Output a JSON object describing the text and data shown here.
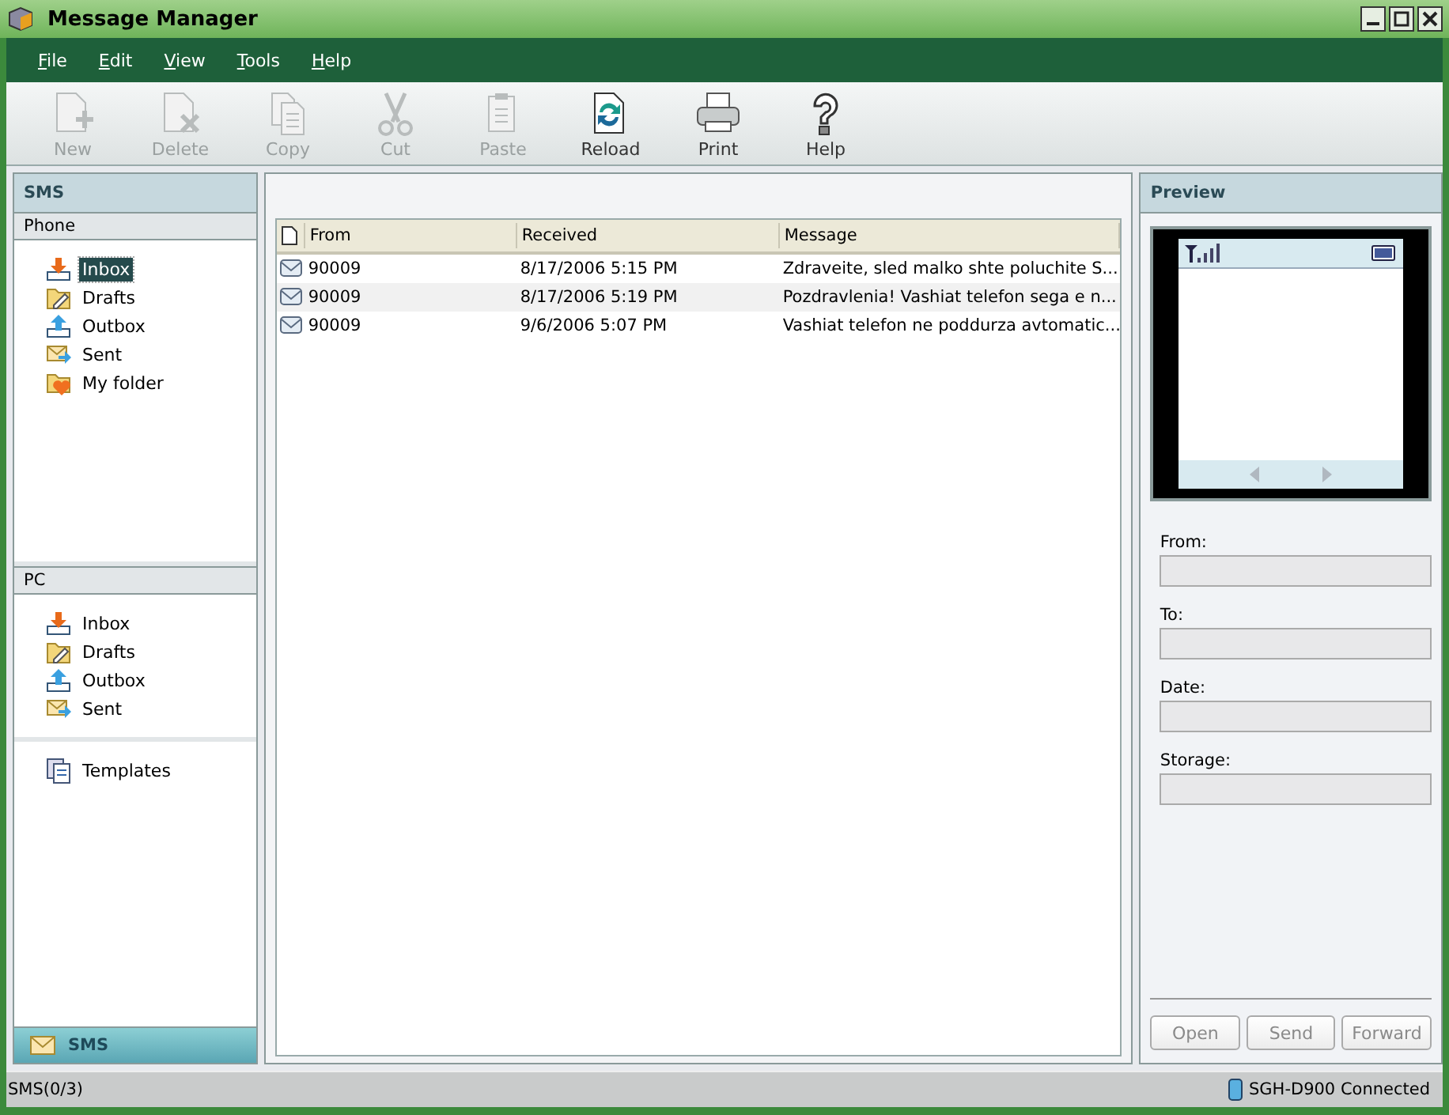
{
  "window": {
    "title": "Message Manager"
  },
  "menu": [
    {
      "label": "File"
    },
    {
      "label": "Edit"
    },
    {
      "label": "View"
    },
    {
      "label": "Tools"
    },
    {
      "label": "Help"
    }
  ],
  "toolbar": [
    {
      "label": "New",
      "kind": "new",
      "disabled": true
    },
    {
      "label": "Delete",
      "kind": "delete",
      "disabled": true
    },
    {
      "label": "Copy",
      "kind": "copy",
      "disabled": true
    },
    {
      "label": "Cut",
      "kind": "cut",
      "disabled": true
    },
    {
      "label": "Paste",
      "kind": "paste",
      "disabled": true
    },
    {
      "label": "Reload",
      "kind": "reload",
      "disabled": false
    },
    {
      "label": "Print",
      "kind": "print",
      "disabled": false
    },
    {
      "label": "Help",
      "kind": "help",
      "disabled": false
    }
  ],
  "sidebar": {
    "title": "SMS",
    "sections": [
      {
        "title": "Phone",
        "items": [
          {
            "label": "Inbox",
            "kind": "inbox",
            "selected": true
          },
          {
            "label": "Drafts",
            "kind": "drafts",
            "selected": false
          },
          {
            "label": "Outbox",
            "kind": "outbox",
            "selected": false
          },
          {
            "label": "Sent",
            "kind": "sent",
            "selected": false
          },
          {
            "label": "My folder",
            "kind": "folder",
            "selected": false
          }
        ]
      },
      {
        "title": "PC",
        "items": [
          {
            "label": "Inbox",
            "kind": "inbox",
            "selected": false
          },
          {
            "label": "Drafts",
            "kind": "drafts",
            "selected": false
          },
          {
            "label": "Outbox",
            "kind": "outbox",
            "selected": false
          },
          {
            "label": "Sent",
            "kind": "sent",
            "selected": false
          }
        ]
      },
      {
        "items": [
          {
            "label": "Templates",
            "kind": "templates",
            "selected": false
          }
        ]
      }
    ],
    "footer": "SMS"
  },
  "table": {
    "columns": [
      "From",
      "Received",
      "Message"
    ],
    "rows": [
      {
        "from": "90009",
        "received": "8/17/2006 5:15 PM",
        "message": "Zdraveite, sled malko shte poluchite S..."
      },
      {
        "from": "90009",
        "received": "8/17/2006 5:19 PM",
        "message": "Pozdravlenia! Vashiat telefon sega e n..."
      },
      {
        "from": "90009",
        "received": "9/6/2006 5:07 PM",
        "message": "Vashiat telefon ne poddurza avtomatic..."
      }
    ]
  },
  "preview": {
    "title": "Preview",
    "fields": [
      {
        "label": "From:"
      },
      {
        "label": "To:"
      },
      {
        "label": "Date:"
      },
      {
        "label": "Storage:"
      }
    ],
    "buttons": [
      {
        "label": "Open",
        "disabled": true
      },
      {
        "label": "Send",
        "disabled": true
      },
      {
        "label": "Forward",
        "disabled": true
      }
    ]
  },
  "status_bar": {
    "left": "SMS(0/3)",
    "right": "SGH-D900 Connected"
  }
}
